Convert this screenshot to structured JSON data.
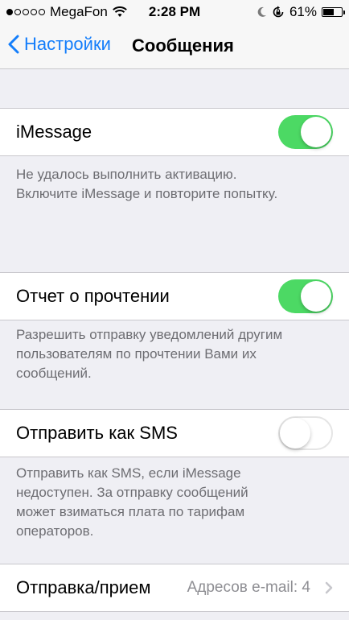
{
  "status_bar": {
    "carrier": "MegaFon",
    "signal_bars_filled": 1,
    "signal_bars_total": 5,
    "time": "2:28 PM",
    "battery_percent": "61%",
    "battery_level": 0.61
  },
  "nav": {
    "back_label": "Настройки",
    "title": "Сообщения"
  },
  "settings": {
    "imessage": {
      "label": "iMessage",
      "enabled": true
    },
    "imessage_footer_line1": "Не удалось выполнить активацию.",
    "imessage_footer_line2": "Включите iMessage и повторите попытку.",
    "read_receipts": {
      "label": "Отчет о прочтении",
      "enabled": true
    },
    "read_receipts_footer_line1": "Разрешить отправку уведомлений другим",
    "read_receipts_footer_line2": "пользователям по прочтении Вами их",
    "read_receipts_footer_line3": "сообщений.",
    "send_as_sms": {
      "label": "Отправить как SMS",
      "enabled": false
    },
    "sms_footer_line1": "Отправить как SMS, если iMessage",
    "sms_footer_line2": "недоступен. За отправку сообщений",
    "sms_footer_line3": "может взиматься плата по тарифам",
    "sms_footer_line4": "операторов.",
    "send_receive": {
      "label": "Отправка/прием",
      "detail": "Адресов e-mail: 4"
    }
  },
  "colors": {
    "accent": "#147efb",
    "toggle_on": "#4cd964",
    "background": "#efeff4",
    "footer_text": "#6d6d72"
  },
  "icons": {
    "signal": "signal-dots-icon",
    "wifi": "wifi-icon",
    "moon": "moon-icon",
    "rotation_lock": "rotation-lock-icon",
    "battery": "battery-icon",
    "back": "chevron-left-icon",
    "disclosure": "chevron-right-icon"
  }
}
